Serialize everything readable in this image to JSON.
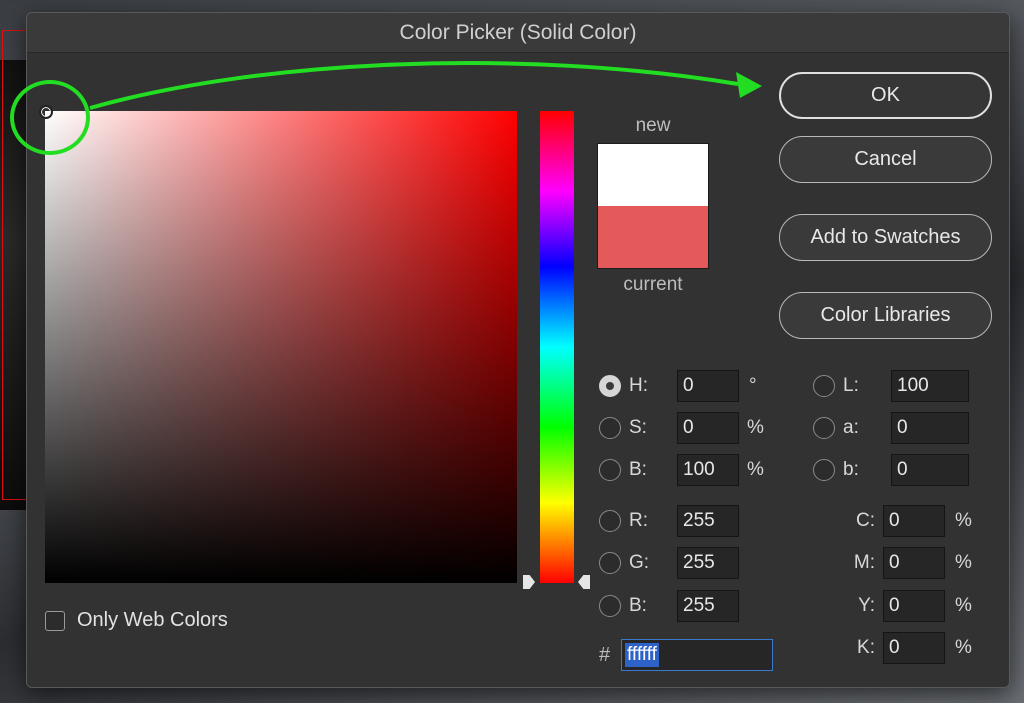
{
  "dialog": {
    "title": "Color Picker (Solid Color)"
  },
  "swatch": {
    "new_label": "new",
    "current_label": "current",
    "new_color": "#ffffff",
    "current_color": "#e45a5a"
  },
  "buttons": {
    "ok": "OK",
    "cancel": "Cancel",
    "add_to_swatches": "Add to Swatches",
    "color_libraries": "Color Libraries"
  },
  "hsb": [
    {
      "label": "H:",
      "value": "0",
      "unit": "°",
      "checked": true
    },
    {
      "label": "S:",
      "value": "0",
      "unit": "%",
      "checked": false
    },
    {
      "label": "B:",
      "value": "100",
      "unit": "%",
      "checked": false
    }
  ],
  "rgb": [
    {
      "label": "R:",
      "value": "255",
      "checked": false
    },
    {
      "label": "G:",
      "value": "255",
      "checked": false
    },
    {
      "label": "B:",
      "value": "255",
      "checked": false
    }
  ],
  "lab": [
    {
      "label": "L:",
      "value": "100",
      "checked": false
    },
    {
      "label": "a:",
      "value": "0",
      "checked": false
    },
    {
      "label": "b:",
      "value": "0",
      "checked": false
    }
  ],
  "cmyk": [
    {
      "label": "C:",
      "value": "0",
      "unit": "%"
    },
    {
      "label": "M:",
      "value": "0",
      "unit": "%"
    },
    {
      "label": "Y:",
      "value": "0",
      "unit": "%"
    },
    {
      "label": "K:",
      "value": "0",
      "unit": "%"
    }
  ],
  "hex": {
    "hash": "#",
    "value": "ffffff"
  },
  "web_colors": {
    "label": "Only Web Colors",
    "checked": false
  },
  "colors": {
    "hue_base": "#ff0000",
    "annotation": "#22dd22"
  }
}
